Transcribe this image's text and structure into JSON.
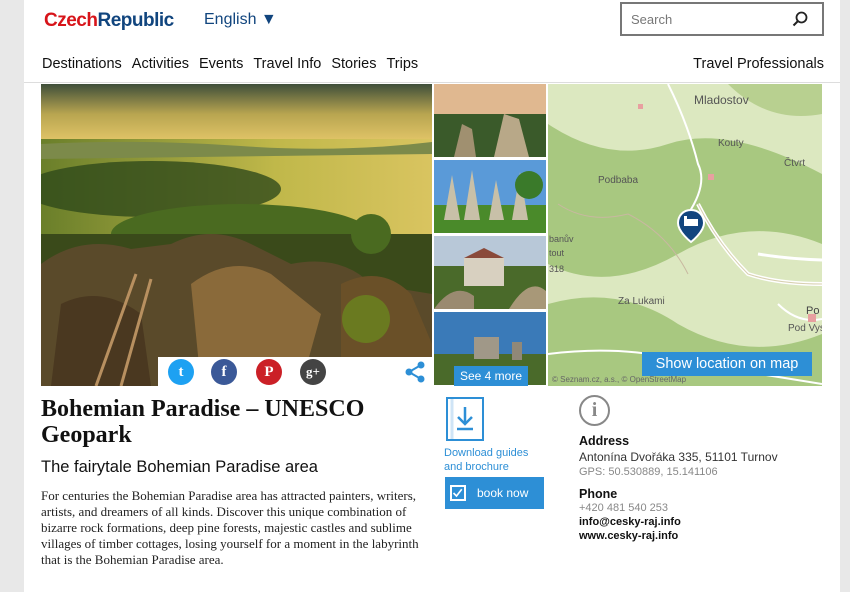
{
  "header": {
    "logo_czech": "Czech",
    "logo_republic": "Republic",
    "language": "English ▼",
    "search_placeholder": "Search"
  },
  "nav": {
    "items": [
      "Destinations",
      "Activities",
      "Events",
      "Travel Info",
      "Stories",
      "Trips"
    ],
    "right": "Travel Professionals"
  },
  "gallery": {
    "see_more": "See 4 more",
    "share": {
      "twitter": "t",
      "facebook": "f",
      "pinterest": "P",
      "google": "g+"
    }
  },
  "map": {
    "labels": [
      "Mladostov",
      "Kouty",
      "Čtvrt",
      "Podbaba",
      "Za Lukami",
      "Po",
      "Pod Vys",
      "banův",
      "tout",
      "318"
    ],
    "attribution": "© Seznam.cz, a.s., © OpenStreetMap",
    "button": "Show location on map"
  },
  "content": {
    "title": "Bohemian Paradise – UNESCO Geopark",
    "subtitle": "The fairytale Bohemian Paradise area",
    "description": "For centuries the Bohemian Paradise area has attracted painters, writers, artists, and dreamers of all kinds. Discover this unique combination of bizarre rock formations, deep pine forests, majestic castles and sublime villages of timber cottages, losing yourself for a moment in the labyrinth that is the Bohemian Paradise area."
  },
  "actions": {
    "download": "Download guides and brochure",
    "book": "book now"
  },
  "info": {
    "address_label": "Address",
    "address": "Antonína Dvořáka 335, 51101 Turnov",
    "gps": "GPS: 50.530889, 15.141106",
    "phone_label": "Phone",
    "phone": "+420 481 540 253",
    "email": "info@cesky-raj.info",
    "web": "www.cesky-raj.info"
  },
  "colors": {
    "accent": "#2d8fd6",
    "brand_red": "#d7141a",
    "brand_blue": "#11457e"
  }
}
